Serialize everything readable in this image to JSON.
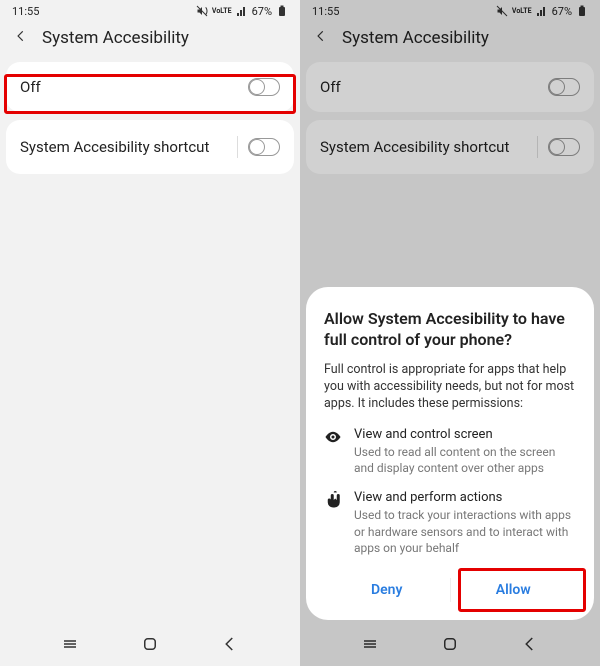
{
  "status": {
    "time": "11:55",
    "battery": "67%"
  },
  "header": {
    "title": "System Accesibility"
  },
  "rows": {
    "main": {
      "label": "Off"
    },
    "shortcut": {
      "label": "System Accesibility shortcut"
    }
  },
  "dialog": {
    "title": "Allow System Accesibility to have full control of your phone?",
    "desc": "Full control is appropriate for apps that help you with accessibility needs, but not for most apps. It includes these permissions:",
    "perm1": {
      "title": "View and control screen",
      "desc": "Used to read all content on the screen and display content over other apps"
    },
    "perm2": {
      "title": "View and perform actions",
      "desc": "Used to track your interactions with apps or hardware sensors and to interact with apps on your behalf"
    },
    "deny": "Deny",
    "allow": "Allow"
  }
}
